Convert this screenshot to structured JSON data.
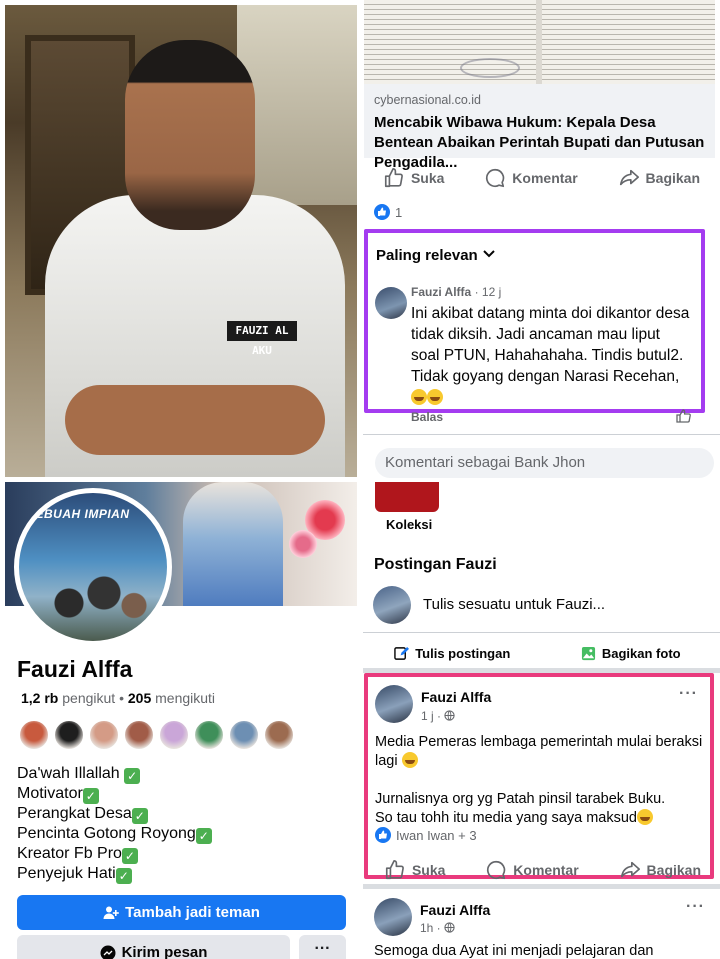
{
  "left": {
    "nametag": "FAUZI AL AKU",
    "cover_banner": "SEBUAH IMPIAN",
    "name": "Fauzi Alffa",
    "followers_count": "1,2 rb",
    "followers_label": "pengikut",
    "following_count": "205",
    "following_label": "mengikuti",
    "bio": [
      "Da'wah Illallah",
      "Motivator",
      "Perangkat Desa",
      "Pencinta Gotong Royong",
      "Kreator Fb Pro",
      "Penyejuk Hati"
    ],
    "add_friend_label": "Tambah jadi teman",
    "message_label": "Kirim pesan",
    "more_label": "···",
    "friend_colors": [
      "#c85a3e",
      "#1e1e1e",
      "#d49b86",
      "#a15c48",
      "#caa6d8",
      "#3f8f5a",
      "#6d8fb3",
      "#9c6b50"
    ]
  },
  "right": {
    "link_domain": "cybernasional.co.id",
    "link_title": "Mencabik Wibawa Hukum: Kepala Desa Bentean Abaikan Perintah Bupati dan Putusan Pengadila...",
    "like_label": "Suka",
    "comment_label": "Komentar",
    "share_label": "Bagikan",
    "reaction_count": "1",
    "sort_label": "Paling relevan",
    "comment": {
      "author": "Fauzi Alffa",
      "time": "· 12 j",
      "text": "Ini akibat datang minta doi dikantor desa tidak diksih. Jadi ancaman mau liput soal PTUN, Hahahahaha. Tindis butul2. Tidak goyang dengan Narasi Recehan,",
      "reply": "Balas"
    },
    "composer_placeholder": "Komentari sebagai Bank Jhon",
    "collection_label": "Koleksi",
    "posts_title": "Postingan Fauzi",
    "write_prompt": "Tulis sesuatu untuk Fauzi...",
    "write_post_label": "Tulis postingan",
    "share_photo_label": "Bagikan foto",
    "post1": {
      "author": "Fauzi Alffa",
      "time": "1 j ·",
      "line1": "Media Pemeras lembaga pemerintah mulai beraksi lagi",
      "line2": "Jurnalisnya org yg Patah pinsil tarabek Buku.",
      "line3": "So tau tohh itu media yang saya maksud",
      "reactions": "Iwan Iwan + 3",
      "more": "···"
    },
    "post2": {
      "author": "Fauzi Alffa",
      "time": "1h ·",
      "text": "Semoga dua Ayat ini menjadi pelajaran dan",
      "more": "···"
    }
  },
  "colors": {
    "accent": "#1877f2",
    "comment_highlight": "#a43cf0",
    "post_highlight": "#e93a7d"
  }
}
